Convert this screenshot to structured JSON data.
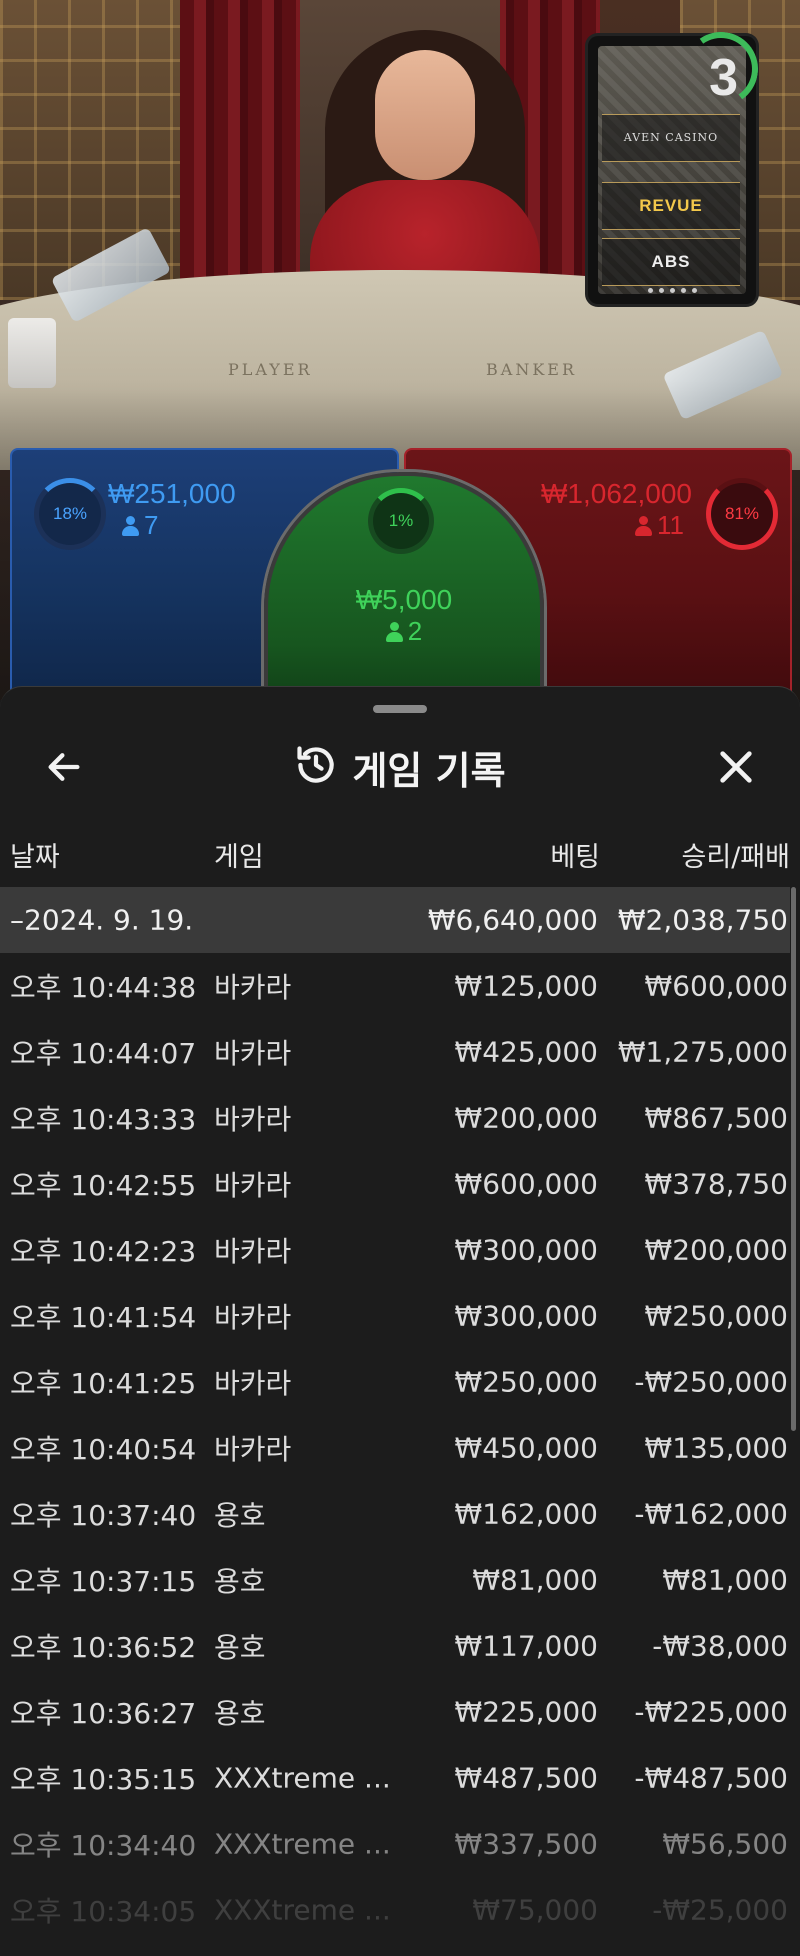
{
  "video": {
    "table_labels": {
      "player": "PLAYER",
      "banker": "BANKER"
    },
    "round_timer": "3",
    "sponsors": [
      "AVEN CASINO",
      "REVUE",
      "ABS"
    ]
  },
  "bets": {
    "player": {
      "percent": "18%",
      "amount": "₩251,000",
      "count": "7",
      "color": "#3f9bf2"
    },
    "tie": {
      "percent": "1%",
      "amount": "₩5,000",
      "count": "2",
      "color": "#3fd25a"
    },
    "banker": {
      "percent": "81%",
      "amount": "₩1,062,000",
      "count": "11",
      "color": "#d8262e"
    }
  },
  "history": {
    "title": "게임 기록",
    "columns": {
      "date": "날짜",
      "game": "게임",
      "bet": "베팅",
      "win_loss": "승리/패배"
    },
    "summary": {
      "date": "–2024. 9. 19.",
      "bet": "₩6,640,000",
      "win_loss": "₩2,038,750"
    },
    "rows": [
      {
        "time": "오후 10:44:38",
        "game": "바카라",
        "bet": "₩125,000",
        "win_loss": "₩600,000"
      },
      {
        "time": "오후 10:44:07",
        "game": "바카라",
        "bet": "₩425,000",
        "win_loss": "₩1,275,000"
      },
      {
        "time": "오후 10:43:33",
        "game": "바카라",
        "bet": "₩200,000",
        "win_loss": "₩867,500"
      },
      {
        "time": "오후 10:42:55",
        "game": "바카라",
        "bet": "₩600,000",
        "win_loss": "₩378,750"
      },
      {
        "time": "오후 10:42:23",
        "game": "바카라",
        "bet": "₩300,000",
        "win_loss": "₩200,000"
      },
      {
        "time": "오후 10:41:54",
        "game": "바카라",
        "bet": "₩300,000",
        "win_loss": "₩250,000"
      },
      {
        "time": "오후 10:41:25",
        "game": "바카라",
        "bet": "₩250,000",
        "win_loss": "-₩250,000"
      },
      {
        "time": "오후 10:40:54",
        "game": "바카라",
        "bet": "₩450,000",
        "win_loss": "₩135,000"
      },
      {
        "time": "오후 10:37:40",
        "game": "용호",
        "bet": "₩162,000",
        "win_loss": "-₩162,000"
      },
      {
        "time": "오후 10:37:15",
        "game": "용호",
        "bet": "₩81,000",
        "win_loss": "₩81,000"
      },
      {
        "time": "오후 10:36:52",
        "game": "용호",
        "bet": "₩117,000",
        "win_loss": "-₩38,000"
      },
      {
        "time": "오후 10:36:27",
        "game": "용호",
        "bet": "₩225,000",
        "win_loss": "-₩225,000"
      },
      {
        "time": "오후 10:35:15",
        "game": "XXXtreme ...",
        "bet": "₩487,500",
        "win_loss": "-₩487,500"
      },
      {
        "time": "오후 10:34:40",
        "game": "XXXtreme ...",
        "bet": "₩337,500",
        "win_loss": "₩56,500"
      },
      {
        "time": "오후 10:34:05",
        "game": "XXXtreme ...",
        "bet": "₩75,000",
        "win_loss": "-₩25,000"
      }
    ]
  }
}
